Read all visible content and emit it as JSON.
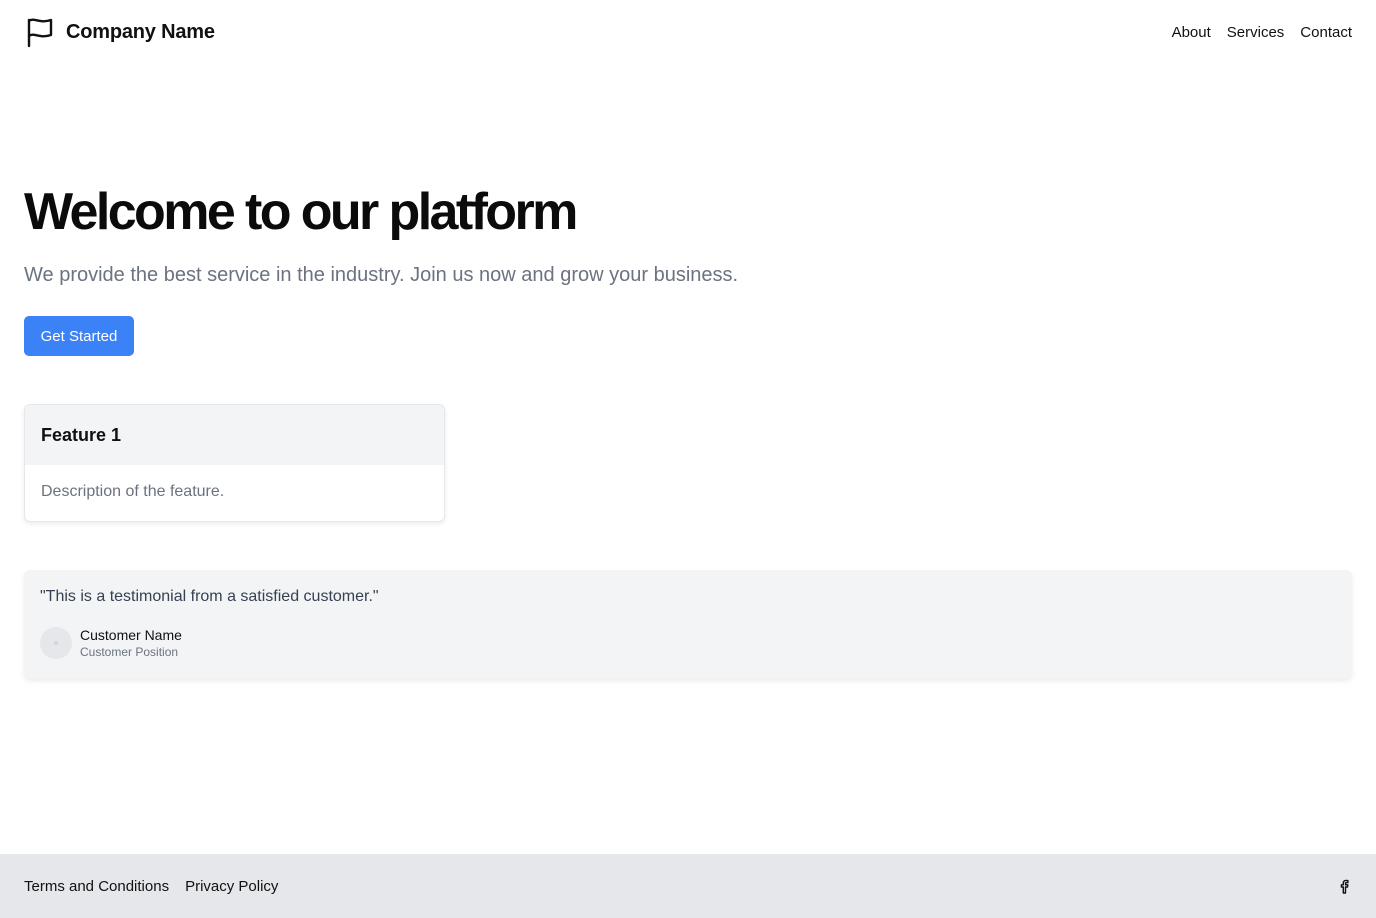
{
  "header": {
    "brand_name": "Company Name",
    "brand_icon": "flag-icon",
    "nav": [
      "About",
      "Services",
      "Contact"
    ]
  },
  "hero": {
    "title": "Welcome to our platform",
    "subtitle": "We provide the best service in the industry. Join us now and grow your business.",
    "cta_label": "Get Started"
  },
  "feature": {
    "title": "Feature 1",
    "description": "Description of the feature."
  },
  "testimonial": {
    "quote": "\"This is a testimonial from a satisfied customer.\"",
    "customer_name": "Customer Name",
    "customer_position": "Customer Position"
  },
  "footer": {
    "links": [
      "Terms and Conditions",
      "Privacy Policy"
    ],
    "social_icon": "facebook-icon"
  },
  "colors": {
    "accent": "#3b82f6",
    "muted_text": "#6b7280",
    "footer_bg": "#e5e7eb",
    "card_header_bg": "#f3f4f6"
  }
}
